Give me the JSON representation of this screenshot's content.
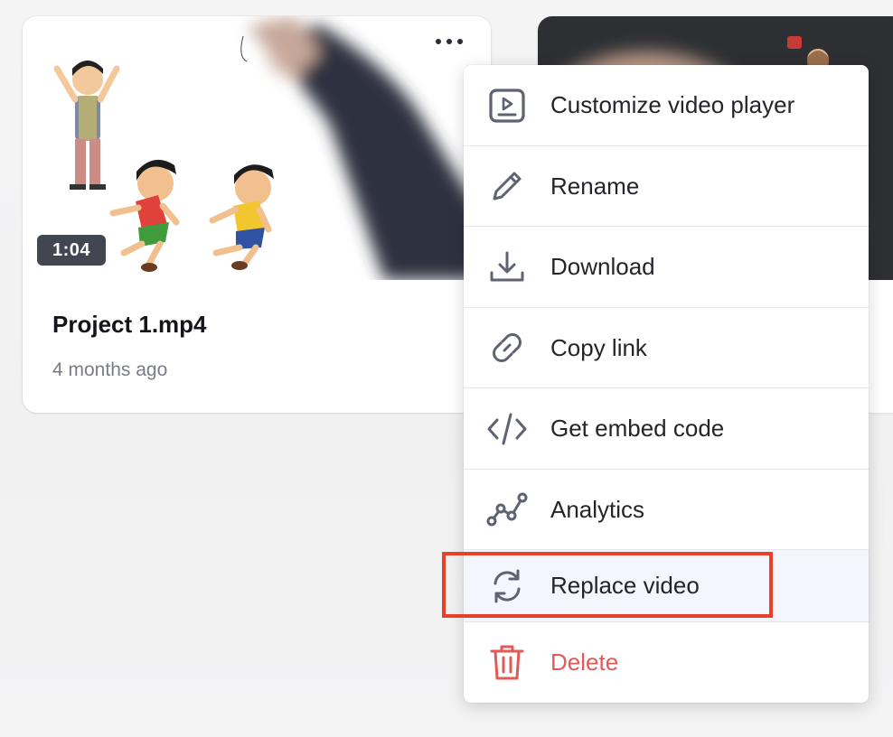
{
  "card": {
    "title": "Project 1.mp4",
    "meta": "4 months ago",
    "duration": "1:04",
    "more_icon": "more-horizontal-icon"
  },
  "menu": {
    "items": [
      {
        "label": "Customize video player",
        "icon": "video-player-icon"
      },
      {
        "label": "Rename",
        "icon": "pencil-icon"
      },
      {
        "label": "Download",
        "icon": "download-icon"
      },
      {
        "label": "Copy link",
        "icon": "link-icon"
      },
      {
        "label": "Get embed code",
        "icon": "code-icon"
      },
      {
        "label": "Analytics",
        "icon": "analytics-icon"
      },
      {
        "label": "Replace video",
        "icon": "replace-icon",
        "highlighted": true
      },
      {
        "label": "Delete",
        "icon": "trash-icon",
        "danger": true
      }
    ]
  },
  "colors": {
    "danger": "#e25a57",
    "highlight_box": "#e8412a",
    "icon": "#5f6270",
    "highlight_bg": "#f3f6fd"
  }
}
